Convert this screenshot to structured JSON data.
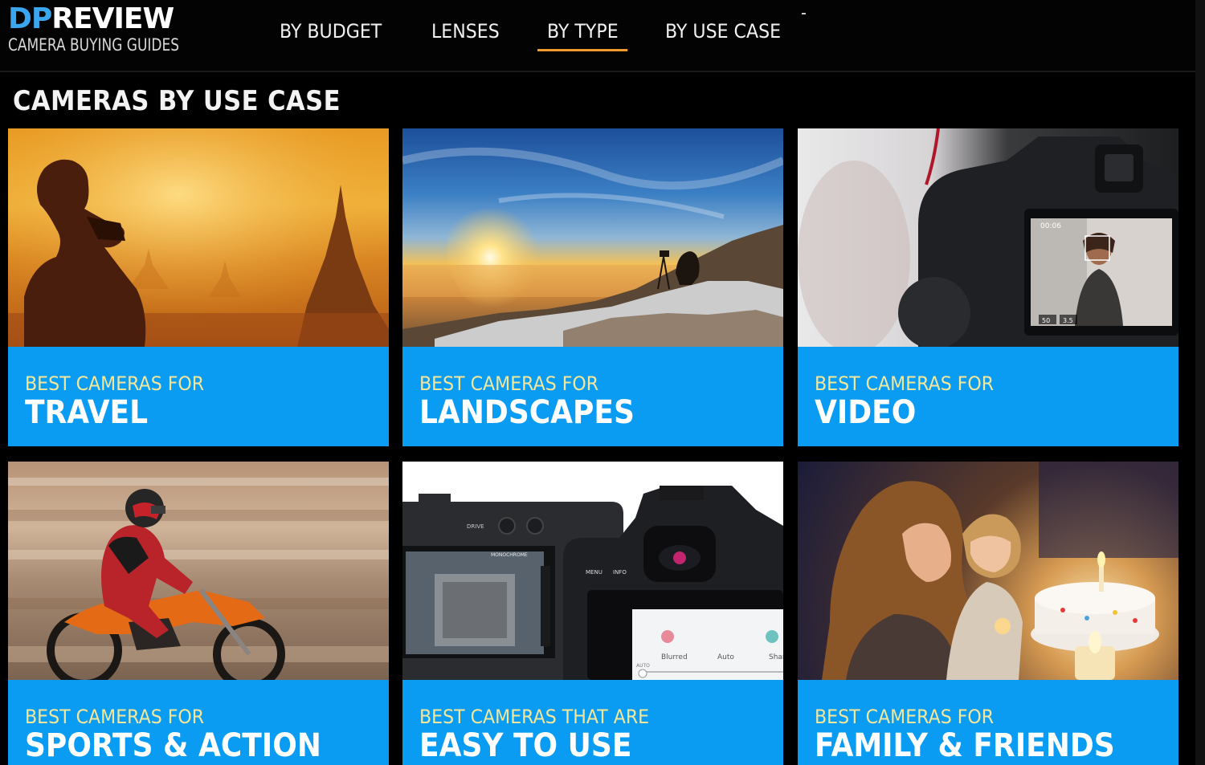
{
  "header": {
    "logo_dp": "DP",
    "logo_review": "REVIEW",
    "logo_sub": "CAMERA BUYING GUIDES",
    "nav": [
      {
        "label": "BY BUDGET",
        "active": false
      },
      {
        "label": "LENSES",
        "active": false
      },
      {
        "label": "BY TYPE",
        "active": true
      },
      {
        "label": "BY USE CASE",
        "active": false
      }
    ],
    "accent_color": "#f39a2e",
    "brand_color": "#3aa6f0"
  },
  "main": {
    "section_title": "CAMERAS BY USE CASE",
    "label_color": "#0a9bf2",
    "cards": [
      {
        "pre": "BEST CAMERAS FOR",
        "title": "TRAVEL"
      },
      {
        "pre": "BEST CAMERAS FOR",
        "title": "LANDSCAPES"
      },
      {
        "pre": "BEST CAMERAS FOR",
        "title": "VIDEO"
      },
      {
        "pre": "BEST CAMERAS FOR",
        "title": "SPORTS & ACTION"
      },
      {
        "pre": "BEST CAMERAS THAT ARE",
        "title": "EASY TO USE"
      },
      {
        "pre": "BEST CAMERAS FOR",
        "title": "FAMILY & FRIENDS"
      }
    ],
    "easy_screen": {
      "drive": "DRIVE",
      "mode": "MONOCHROME",
      "menu": "MENU",
      "info": "INFO",
      "auto_small": "AUTO",
      "blurred": "Blurred",
      "auto": "Auto",
      "sharp": "Shar"
    },
    "video_screen": {
      "time": "00:06",
      "val1": "50",
      "val2": "3.5"
    }
  }
}
